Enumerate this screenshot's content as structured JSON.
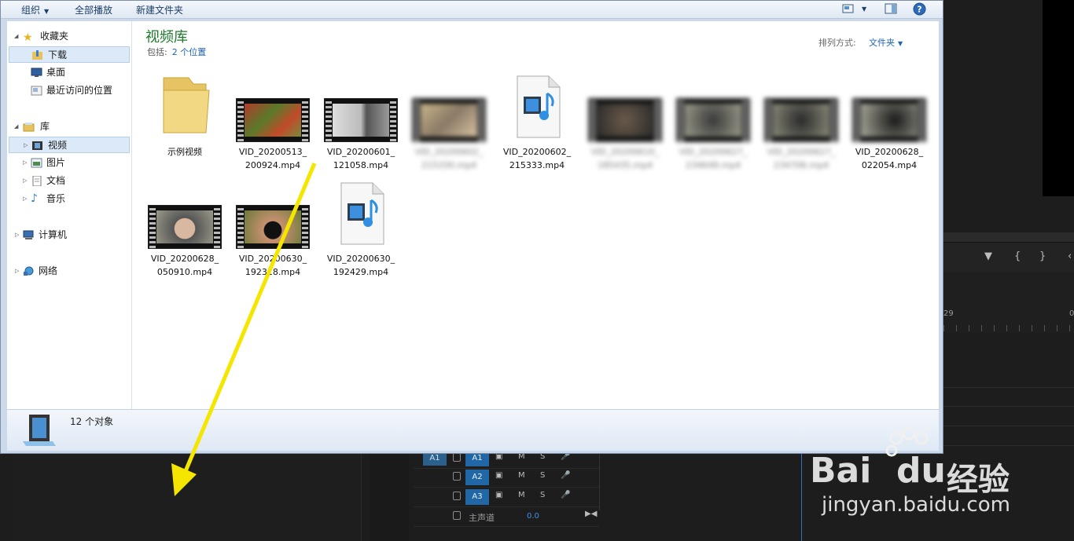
{
  "toolbar": {
    "organize_label": "组织",
    "play_all_label": "全部播放",
    "new_folder_label": "新建文件夹",
    "view_icon": "view-options-icon",
    "preview_icon": "preview-pane-icon",
    "help_icon": "help-icon"
  },
  "nav": {
    "favorites": "收藏夹",
    "downloads": "下载",
    "desktop": "桌面",
    "recent": "最近访问的位置",
    "libraries": "库",
    "videos": "视频",
    "pictures": "图片",
    "documents": "文档",
    "music": "音乐",
    "computer": "计算机",
    "network": "网络"
  },
  "content": {
    "title": "视频库",
    "subtitle_prefix": "包括:",
    "subtitle_link": "2 个位置",
    "sort_label": "排列方式:",
    "sort_value": "文件夹"
  },
  "files": [
    {
      "line1": "示例视频",
      "line2": ""
    },
    {
      "line1": "VID_20200513_",
      "line2": "200924.mp4"
    },
    {
      "line1": "VID_20200601_",
      "line2": "121058.mp4"
    },
    {
      "line1": "VID_20200602_",
      "line2": "215330.mp4"
    },
    {
      "line1": "VID_20200602_",
      "line2": "215333.mp4"
    },
    {
      "line1": "VID_20200610_",
      "line2": "185435.mp4"
    },
    {
      "line1": "VID_20200627_",
      "line2": "234648.mp4"
    },
    {
      "line1": "VID_20200627_",
      "line2": "234706.mp4"
    },
    {
      "line1": "VID_20200628_",
      "line2": "022054.mp4"
    },
    {
      "line1": "VID_20200628_",
      "line2": "050910.mp4"
    },
    {
      "line1": "VID_20200630_",
      "line2": "192318.mp4"
    },
    {
      "line1": "VID_20200630_",
      "line2": "192429.mp4"
    }
  ],
  "status": {
    "count": "12 个对象"
  },
  "premiere": {
    "ruler_label": "29",
    "ruler_label2": "0",
    "tracks": [
      {
        "src": "A1",
        "tgt": "A1",
        "m": "M",
        "s": "S"
      },
      {
        "src": "",
        "tgt": "A2",
        "m": "M",
        "s": "S"
      },
      {
        "src": "",
        "tgt": "A3",
        "m": "M",
        "s": "S"
      }
    ],
    "master_label": "主声道",
    "master_value": "0.0"
  },
  "watermark": {
    "brand": "Bai",
    "brand2": "du",
    "cn": "经验",
    "url": "jingyan.baidu.com"
  },
  "colors": {
    "library_title": "#1e7a2c",
    "link": "#1f63b5",
    "arrow": "#f5e600",
    "track_target": "#2267a5"
  }
}
